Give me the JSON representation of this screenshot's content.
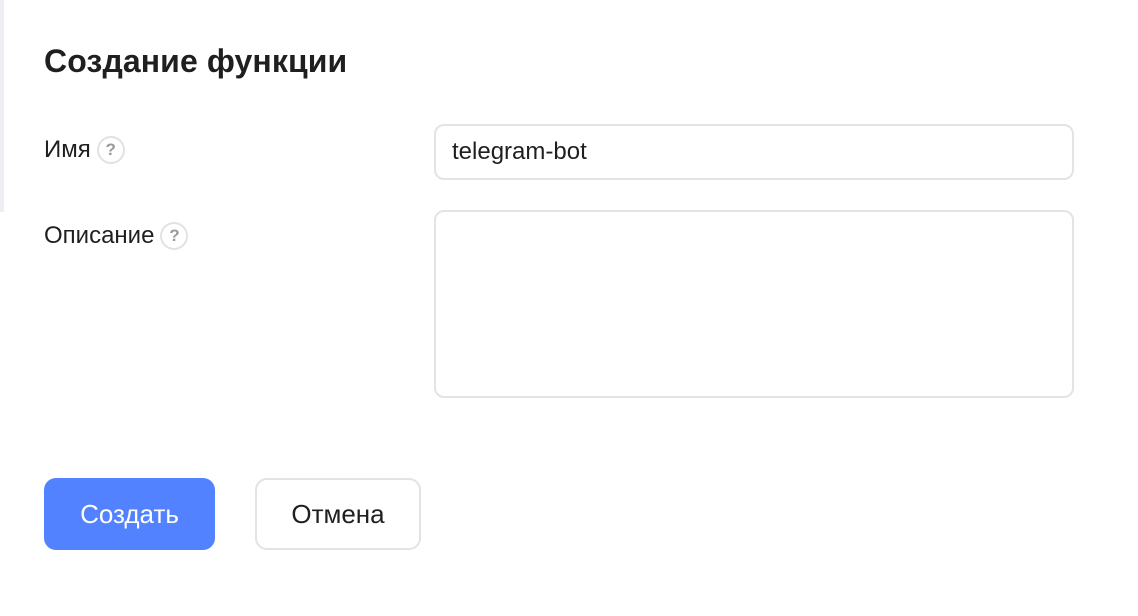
{
  "dialog": {
    "title": "Создание функции",
    "fields": {
      "name": {
        "label": "Имя",
        "help": "?",
        "value": "telegram-bot"
      },
      "description": {
        "label": "Описание",
        "help": "?",
        "value": ""
      }
    },
    "actions": {
      "create_label": "Создать",
      "cancel_label": "Отмена"
    }
  },
  "colors": {
    "accent": "#5282ff",
    "border": "#e3e3e3",
    "text": "#1f1f1f"
  },
  "icons": {
    "help": "question-circle-icon"
  }
}
